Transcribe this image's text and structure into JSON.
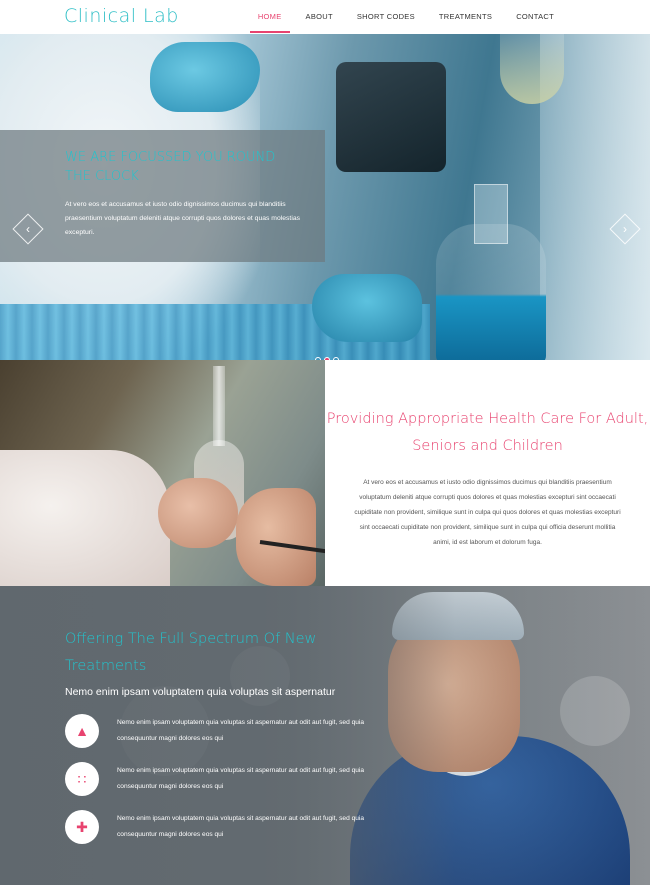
{
  "nav": {
    "logo": "Clinical Lab",
    "items": [
      {
        "label": "HOME",
        "active": true
      },
      {
        "label": "ABOUT",
        "active": false
      },
      {
        "label": "SHORT CODES",
        "active": false
      },
      {
        "label": "TREATMENTS",
        "active": false
      },
      {
        "label": "CONTACT",
        "active": false
      }
    ]
  },
  "hero": {
    "title": "WE ARE FOCUSSED YOU ROUND THE CLOCK",
    "text": "At vero eos et accusamus et iusto odio dignissimos ducimus qui blanditiis praesentium voluptatum deleniti atque corrupti quos dolores et quas molestias excepturi.",
    "prev_icon": "chevron-left-icon",
    "next_icon": "chevron-right-icon",
    "slides": 3,
    "active_slide": 2
  },
  "care": {
    "title": "Providing Appropriate Health Care For Adult, Seniors and Children",
    "body": "At vero eos et accusamus et iusto odio dignissimos ducimus qui blanditiis praesentium voluptatum deleniti atque corrupti quos dolores et quas molestias excepturi sint occaecati cupiditate non provident, similique sunt in culpa qui quos dolores et quas molestias excepturi sint occaecati cupiditate non provident, similique sunt in culpa qui officia deserunt mollitia animi, id est laborum et dolorum fuga."
  },
  "treatments": {
    "title": "Offering The Full Spectrum Of New Treatments",
    "subtitle": "Nemo enim ipsam voluptatem quia voluptas sit aspernatur",
    "services": [
      {
        "icon": "graduation-cap-icon",
        "text": "Nemo enim ipsam voluptatem quia voluptas sit aspernatur aut odit aut fugit, sed quia consequuntur magni dolores eos qui"
      },
      {
        "icon": "sitemap-icon",
        "text": "Nemo enim ipsam voluptatem quia voluptas sit aspernatur aut odit aut fugit, sed quia consequuntur magni dolores eos qui"
      },
      {
        "icon": "medical-cross-icon",
        "text": "Nemo enim ipsam voluptatem quia voluptas sit aspernatur aut odit aut fugit, sed quia consequuntur magni dolores eos qui"
      }
    ]
  },
  "colors": {
    "accent_pink": "#e8436f",
    "accent_teal": "#23c3cc",
    "overlay_gray": "#6e7a80"
  }
}
